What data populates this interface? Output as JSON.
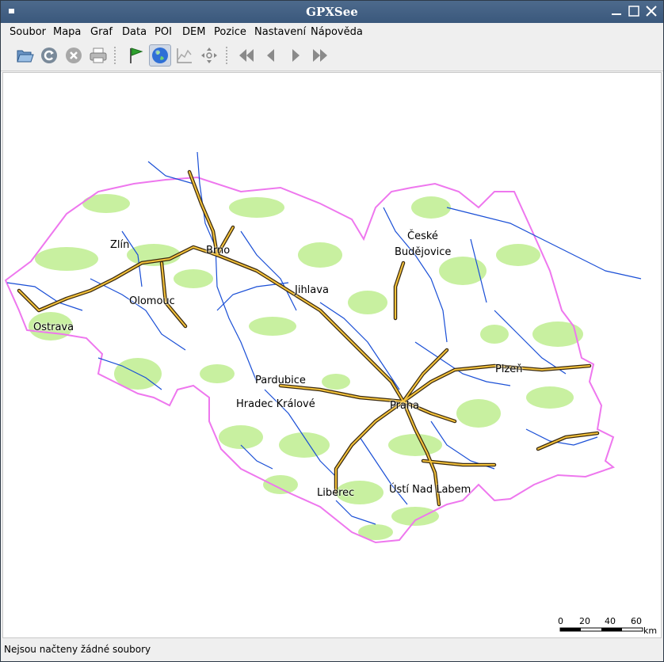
{
  "window": {
    "title": "GPXSee"
  },
  "menu": [
    "Soubor",
    "Mapa",
    "Graf",
    "Data",
    "POI",
    "DEM",
    "Pozice",
    "Nastavení",
    "Nápověda"
  ],
  "toolbar": {
    "buttons": [
      "open-icon",
      "reload-icon",
      "close-file-icon",
      "print-icon",
      "show-poi-icon",
      "show-map-icon",
      "show-graphs-icon",
      "position-icon",
      "first-icon",
      "previous-icon",
      "next-icon",
      "last-icon"
    ],
    "active": [
      "show-map-icon"
    ]
  },
  "map": {
    "cities": [
      "Zlín",
      "Brno",
      "České",
      "Budějovice",
      "Olomouc",
      "Jihlava",
      "Ostrava",
      "Plzeň",
      "Pardubice",
      "Hradec Králové",
      "Praha",
      "Liberec",
      "Ústí Nad Labem"
    ],
    "scale": {
      "labels": [
        "0",
        "20",
        "40",
        "60"
      ],
      "unit": "km"
    },
    "colors": {
      "border": "#ee77ee",
      "rivers": "#1a4fd6",
      "forests": "#c8f0a0",
      "roads": "#3a2a10",
      "road_fill": "#f4c23a"
    }
  },
  "status": {
    "text": "Nejsou načteny žádné soubory"
  }
}
